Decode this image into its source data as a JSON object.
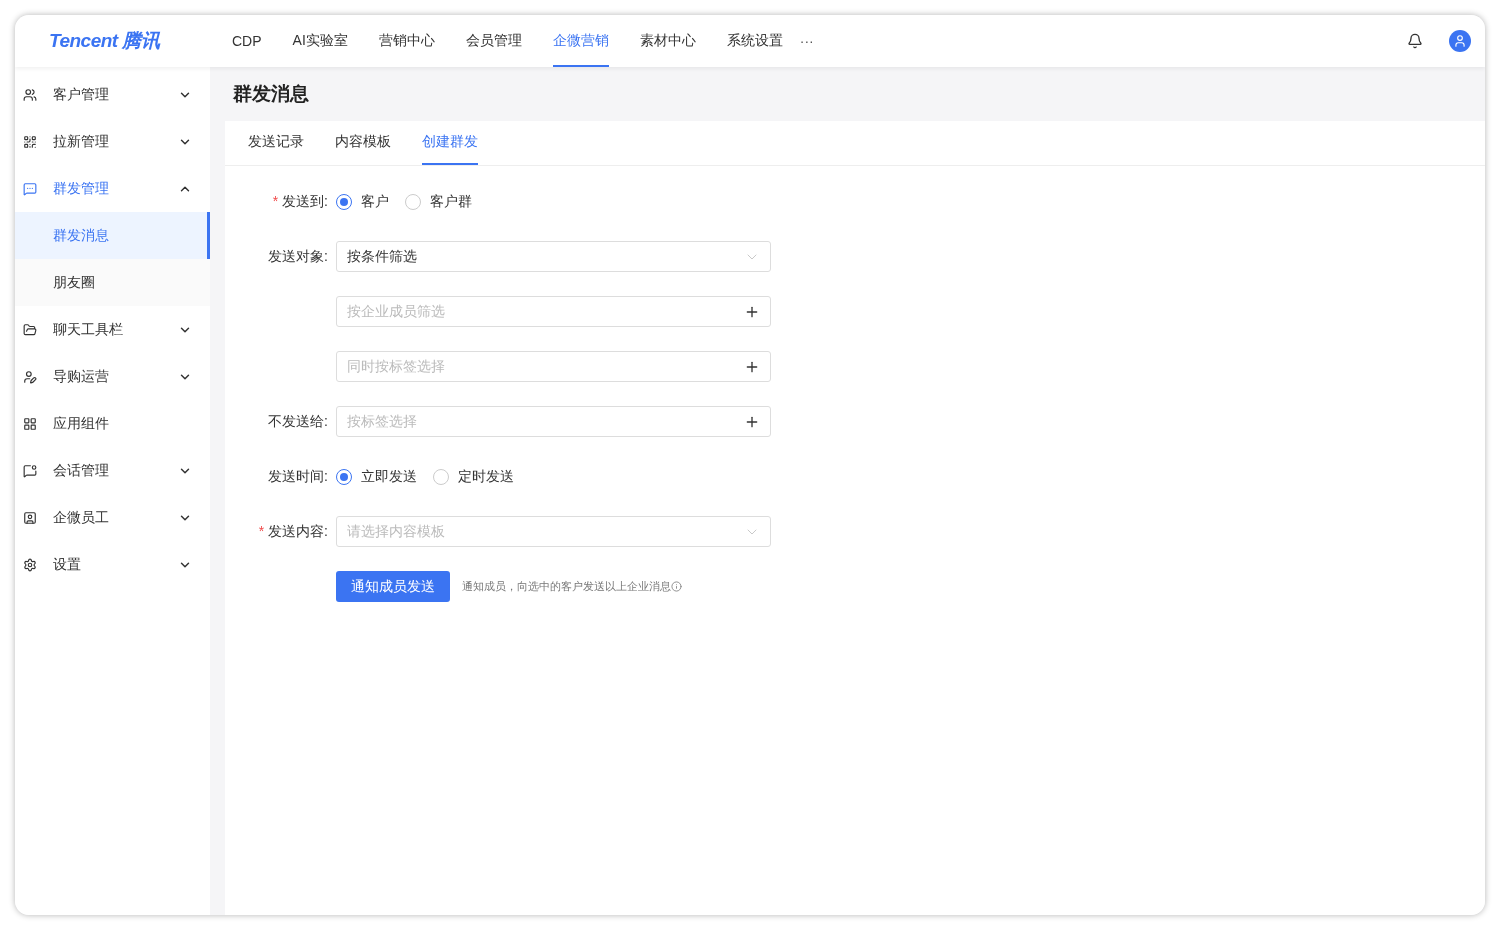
{
  "header": {
    "logo": "Tencent 腾讯",
    "nav": [
      {
        "label": "CDP",
        "selected": false
      },
      {
        "label": "AI实验室",
        "selected": false
      },
      {
        "label": "营销中心",
        "selected": false
      },
      {
        "label": "会员管理",
        "selected": false
      },
      {
        "label": "企微营销",
        "selected": true
      },
      {
        "label": "素材中心",
        "selected": false
      },
      {
        "label": "系统设置",
        "selected": false
      }
    ],
    "more": "···"
  },
  "sidebar": {
    "items": [
      {
        "label": "客户管理",
        "expanded": false,
        "selected": false
      },
      {
        "label": "拉新管理",
        "expanded": false,
        "selected": false
      },
      {
        "label": "群发管理",
        "expanded": true,
        "selected": true,
        "children": [
          {
            "label": "群发消息",
            "selected": true
          },
          {
            "label": "朋友圈",
            "selected": false
          }
        ]
      },
      {
        "label": "聊天工具栏",
        "expanded": false,
        "selected": false
      },
      {
        "label": "导购运营",
        "expanded": false,
        "selected": false
      },
      {
        "label": "应用组件",
        "kind": "leaf",
        "selected": false
      },
      {
        "label": "会话管理",
        "expanded": false,
        "selected": false
      },
      {
        "label": "企微员工",
        "expanded": false,
        "selected": false
      },
      {
        "label": "设置",
        "expanded": false,
        "selected": false
      }
    ]
  },
  "page": {
    "title": "群发消息",
    "tabs": [
      {
        "label": "发送记录",
        "selected": false
      },
      {
        "label": "内容模板",
        "selected": false
      },
      {
        "label": "创建群发",
        "selected": true
      }
    ],
    "form": [
      {
        "kind": "radio",
        "required_mark": "*",
        "label": "发送到:",
        "options": [
          {
            "label": "客户",
            "selected": true
          },
          {
            "label": "客户群",
            "selected": false
          }
        ]
      },
      {
        "kind": "select",
        "label": "发送对象:",
        "value": "按条件筛选"
      },
      {
        "kind": "add",
        "placeholder": "按企业成员筛选"
      },
      {
        "kind": "add",
        "placeholder": "同时按标签选择"
      },
      {
        "kind": "add",
        "label": "不发送给:",
        "placeholder": "按标签选择"
      },
      {
        "kind": "radio",
        "label": "发送时间:",
        "options": [
          {
            "label": "立即发送",
            "selected": true
          },
          {
            "label": "定时发送",
            "selected": false
          }
        ]
      },
      {
        "kind": "select",
        "required_mark": "*",
        "label": "发送内容:",
        "placeholder": "请选择内容模板"
      },
      {
        "kind": "button",
        "button": "通知成员发送",
        "hint": "通知成员，向选中的客户发送以上企业消息"
      }
    ]
  }
}
